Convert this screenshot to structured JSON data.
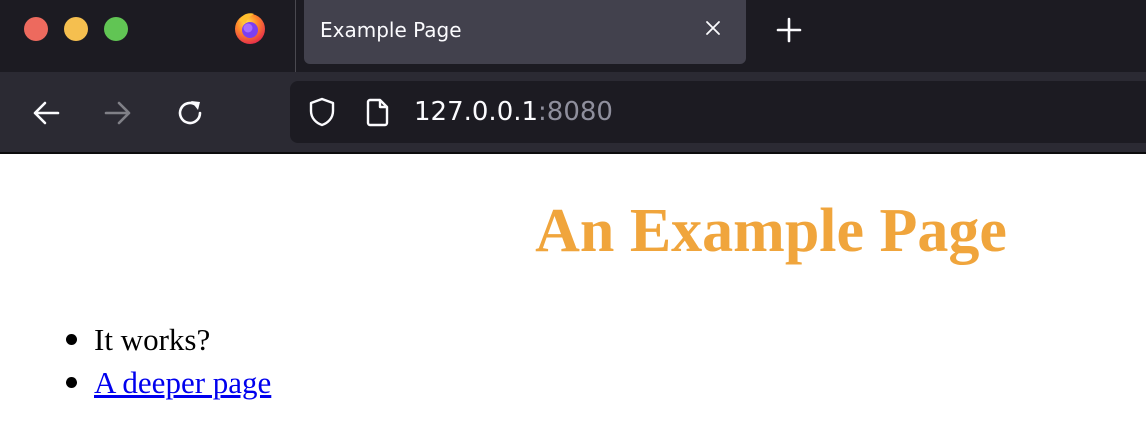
{
  "window": {
    "traffic_lights": {
      "close_color": "#ed6a5e",
      "minimize_color": "#f5bf4f",
      "maximize_color": "#61c554"
    }
  },
  "tabs": [
    {
      "title": "Example Page",
      "active": true,
      "close_icon": "close-icon"
    }
  ],
  "toolbar": {
    "new_tab_icon": "plus-icon",
    "back_icon": "arrow-left-icon",
    "forward_icon": "arrow-right-icon",
    "forward_enabled": false,
    "reload_icon": "reload-icon"
  },
  "urlbar": {
    "host": "127.0.0.1",
    "port": ":8080",
    "security_icon": "shield-icon",
    "page_icon": "page-icon"
  },
  "page": {
    "heading": "An Example Page",
    "heading_color": "#f0a53c",
    "list": [
      {
        "text": "It works?",
        "is_link": false
      },
      {
        "text": "A deeper page",
        "is_link": true,
        "link_color": "#0000ee"
      }
    ]
  }
}
